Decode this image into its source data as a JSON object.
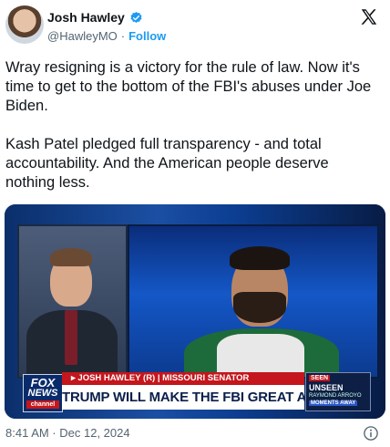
{
  "header": {
    "name": "Josh Hawley",
    "handle": "@HawleyMO",
    "separator": "·",
    "follow_label": "Follow",
    "verified_color": "#1d9bf0"
  },
  "tweet": {
    "paragraph_1": "Wray resigning is a victory for the rule of law. Now it's time to get to the bottom of the FBI's abuses under Joe Biden.",
    "paragraph_2": "Kash Patel pledged full transparency - and total accountability. And the American people deserve nothing less."
  },
  "media": {
    "network_logo_line1": "FOX",
    "network_logo_line2": "NEWS",
    "network_logo_line3": "channel",
    "chyron_top": "▸ JOSH HAWLEY (R) | MISSOURI SENATOR",
    "chyron_main": "TRUMP WILL MAKE THE FBI GREAT AGAIN",
    "promo_line1": "SEEN",
    "promo_line2": "UNSEEN",
    "promo_line3": "RAYMOND ARROYO",
    "promo_line4": "MOMENTS AWAY"
  },
  "footer": {
    "timestamp": "8:41 AM · Dec 12, 2024"
  },
  "icons": {
    "verified": "verified-badge-icon",
    "logo": "x-logo-icon",
    "info": "info-icon"
  }
}
